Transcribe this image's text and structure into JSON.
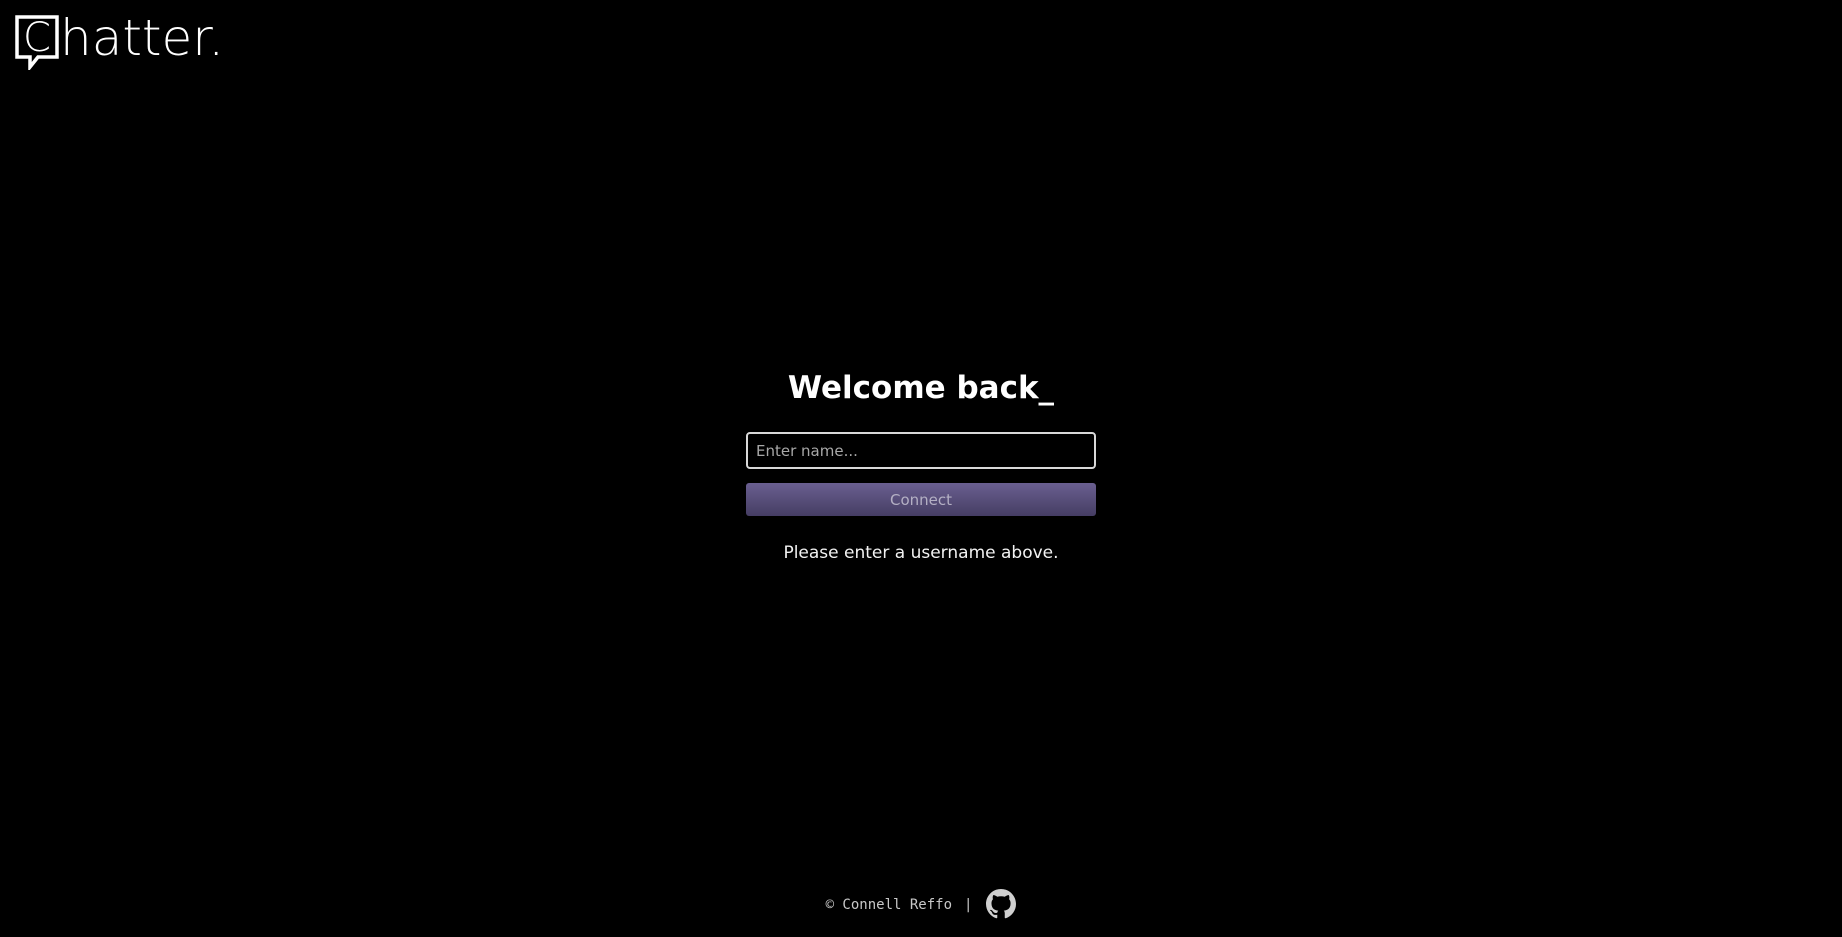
{
  "logo": {
    "mark_letter": "C",
    "text": "hatter."
  },
  "login": {
    "title": "Welcome back_",
    "name_placeholder": "Enter name...",
    "name_value": "",
    "connect_label": "Connect",
    "status": "Please enter a username above."
  },
  "footer": {
    "copyright": "© Connell Reffo",
    "separator": "|",
    "github_icon": "github-icon"
  },
  "colors": {
    "background": "#000000",
    "button_top": "#6a5f90",
    "button_bottom": "#453d63",
    "text": "#ffffff"
  }
}
